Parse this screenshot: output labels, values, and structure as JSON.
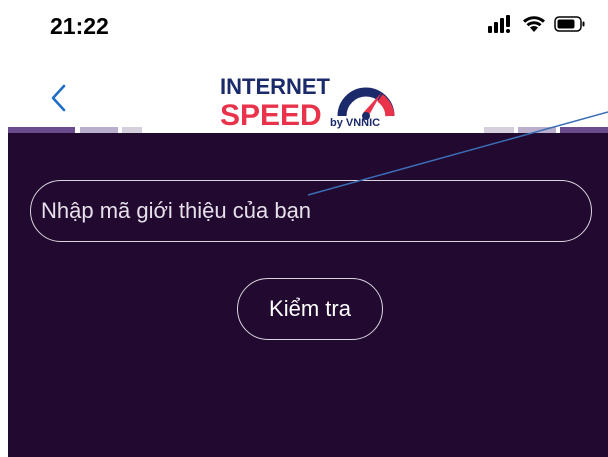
{
  "status_bar": {
    "time": "21:22",
    "icons": [
      "signal-icon",
      "wifi-icon",
      "battery-icon"
    ]
  },
  "nav": {
    "back_icon": "chevron-left-icon",
    "logo": {
      "line1": "INTERNET",
      "line2": "SPEED",
      "by": "by VNNIC"
    }
  },
  "form": {
    "input_placeholder": "Nhập mã giới thiệu của bạn",
    "input_value": "",
    "check_button_label": "Kiểm tra"
  },
  "colors": {
    "background": "#21092f",
    "accent_blue": "#1f6fc6",
    "brand_navy": "#1b2a6b",
    "brand_red": "#e8334a"
  }
}
